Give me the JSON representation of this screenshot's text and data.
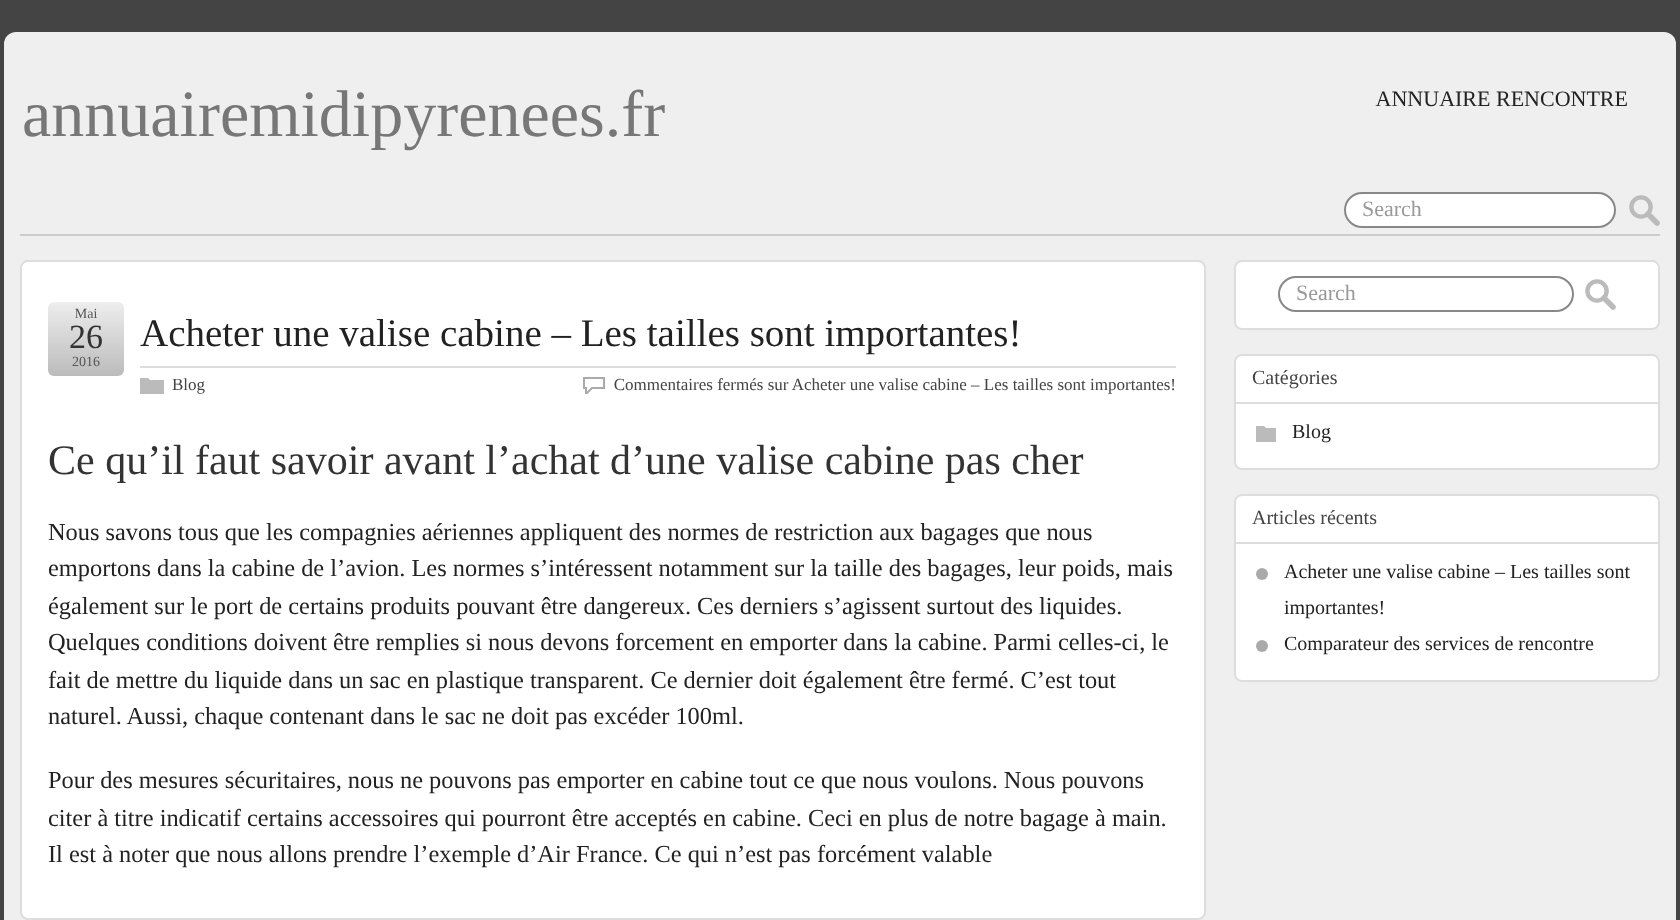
{
  "header": {
    "site_title": "annuairemidipyrenees.fr",
    "nav": [
      {
        "label": "ANNUAIRE RENCONTRE"
      }
    ],
    "search": {
      "placeholder": "Search"
    }
  },
  "post": {
    "date": {
      "month": "Mai",
      "day": "26",
      "year": "2016"
    },
    "title": "Acheter une valise cabine – Les tailles sont importantes!",
    "category": "Blog",
    "comments": "Commentaires fermés sur Acheter une valise cabine – Les tailles sont importantes!",
    "heading": "Ce qu’il faut savoir avant l’achat d’une valise cabine pas cher",
    "paragraphs": [
      "Nous savons tous que les compagnies aériennes appliquent des normes de restriction aux bagages que nous emportons dans la cabine de l’avion. Les normes s’intéressent notamment sur la taille des bagages, leur poids, mais également sur le port de certains produits pouvant être dangereux. Ces derniers s’agissent surtout des liquides. Quelques conditions doivent être remplies si nous devons forcement en emporter dans la cabine. Parmi celles-ci, le fait de mettre du liquide dans un sac en plastique transparent. Ce dernier doit également être fermé. C’est tout naturel. Aussi, chaque contenant dans le sac ne doit pas excéder 100ml.",
      "Pour des mesures sécuritaires, nous ne pouvons pas emporter en cabine tout ce que nous voulons. Nous pouvons citer à titre indicatif certains accessoires qui pourront être acceptés en cabine. Ceci en plus de notre bagage à main. Il est à noter que nous allons prendre l’exemple d’Air France. Ce qui n’est pas forcément valable"
    ]
  },
  "sidebar": {
    "search": {
      "placeholder": "Search"
    },
    "widgets": [
      {
        "kind": "categories",
        "title": "Catégories",
        "items": [
          "Blog"
        ]
      },
      {
        "kind": "recent",
        "title": "Articles récents",
        "items": [
          "Acheter une valise cabine – Les tailles sont importantes!",
          "Comparateur des services de rencontre"
        ]
      }
    ]
  }
}
